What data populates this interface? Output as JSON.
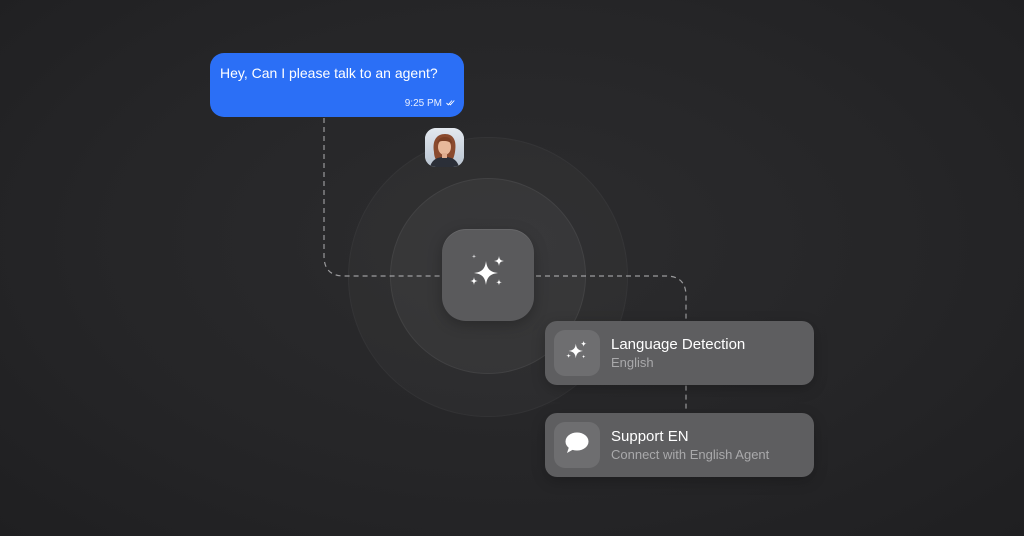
{
  "message": {
    "text": "Hey, Can I please talk to an agent?",
    "time": "9:25 PM",
    "status_icon": "double-check-icon",
    "bubble_color": "#2b6ff6"
  },
  "avatar": {
    "icon": "user-avatar-photo"
  },
  "hub": {
    "icon": "sparkles-icon"
  },
  "steps": [
    {
      "icon": "sparkles-icon",
      "title": "Language Detection",
      "subtitle": "English"
    },
    {
      "icon": "chat-bubble-icon",
      "title": "Support EN",
      "subtitle": "Connect with English Agent"
    }
  ],
  "colors": {
    "background": "#262628",
    "card": "#5e5e60",
    "card_icon_tile": "#6e6e70",
    "hub": "#5a5a5c",
    "subtitle": "#a9a9ab"
  }
}
